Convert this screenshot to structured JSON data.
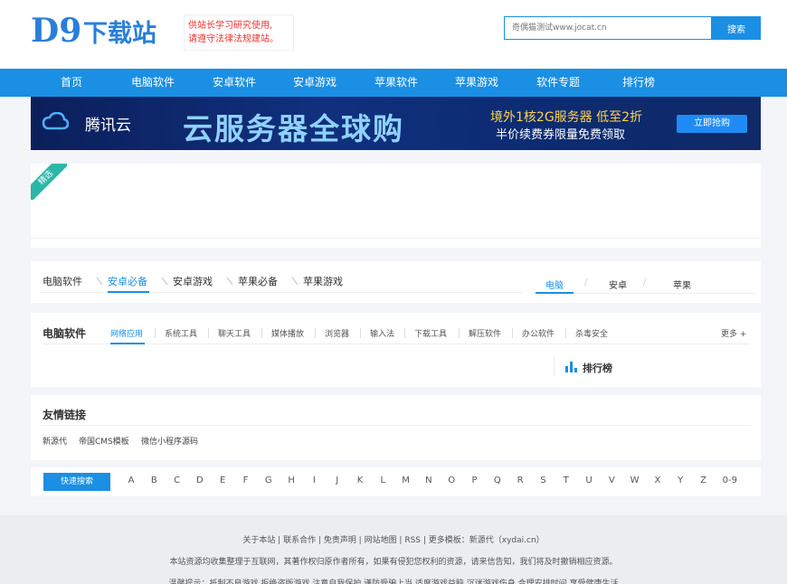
{
  "header": {
    "logo_text": "D9下载站",
    "notice_line1": "供站长学习研究使用,",
    "notice_line2": "请遵守法律法规建站。",
    "search_placeholder": "奇偶猫测试www.jocat.cn",
    "search_button": "搜索"
  },
  "nav": {
    "items": [
      "首页",
      "电脑软件",
      "安卓软件",
      "安卓游戏",
      "苹果软件",
      "苹果游戏",
      "软件专题",
      "排行榜"
    ]
  },
  "banner": {
    "brand": "腾讯云",
    "headline": "云服务器全球购",
    "line1": "境外1核2G服务器 低至2折",
    "line2": "半价续费券限量免费领取",
    "cta": "立即抢购"
  },
  "featured": {
    "ribbon": "精选"
  },
  "category_tabs": {
    "items": [
      "电脑软件",
      "安卓必备",
      "安卓游戏",
      "苹果必备",
      "苹果游戏"
    ],
    "platforms": [
      "电脑",
      "安卓",
      "苹果"
    ]
  },
  "software_section": {
    "title": "电脑软件",
    "subtabs": [
      "网络应用",
      "系统工具",
      "聊天工具",
      "媒体播放",
      "浏览器",
      "输入法",
      "下载工具",
      "解压软件",
      "办公软件",
      "杀毒安全"
    ],
    "more": "更多 +",
    "ranking": "排行榜"
  },
  "links_section": {
    "title": "友情链接",
    "links": [
      "新源代",
      "帝国CMS模板",
      "微信小程序源码"
    ]
  },
  "alphabet": {
    "quick_search": "快速搜索",
    "letters": [
      "A",
      "B",
      "C",
      "D",
      "E",
      "F",
      "G",
      "H",
      "I",
      "J",
      "K",
      "L",
      "M",
      "N",
      "O",
      "P",
      "Q",
      "R",
      "S",
      "T",
      "U",
      "V",
      "W",
      "X",
      "Y",
      "Z",
      "0-9"
    ]
  },
  "footer": {
    "line1": "关于本站 | 联系合作 | 免责声明 | 网站地图 | RSS | 更多模板：新源代（xydai.cn）",
    "line2": "本站资源均收集整理于互联网，其著作权归原作者所有，如果有侵犯您权利的资源，请来信告知，我们将及时撤销相应资源。",
    "line3": "温馨提示：抵制不良游戏 拒绝盗版游戏 注意自我保护 谨防受骗上当 适度游戏益脑 沉迷游戏伤身 合理安排时间 享受健康生活"
  },
  "colors": {
    "accent": "#1a8fe3",
    "notice": "#e33333",
    "ribbon": "#2bb7a8",
    "banner_highlight": "#ffd34d"
  }
}
